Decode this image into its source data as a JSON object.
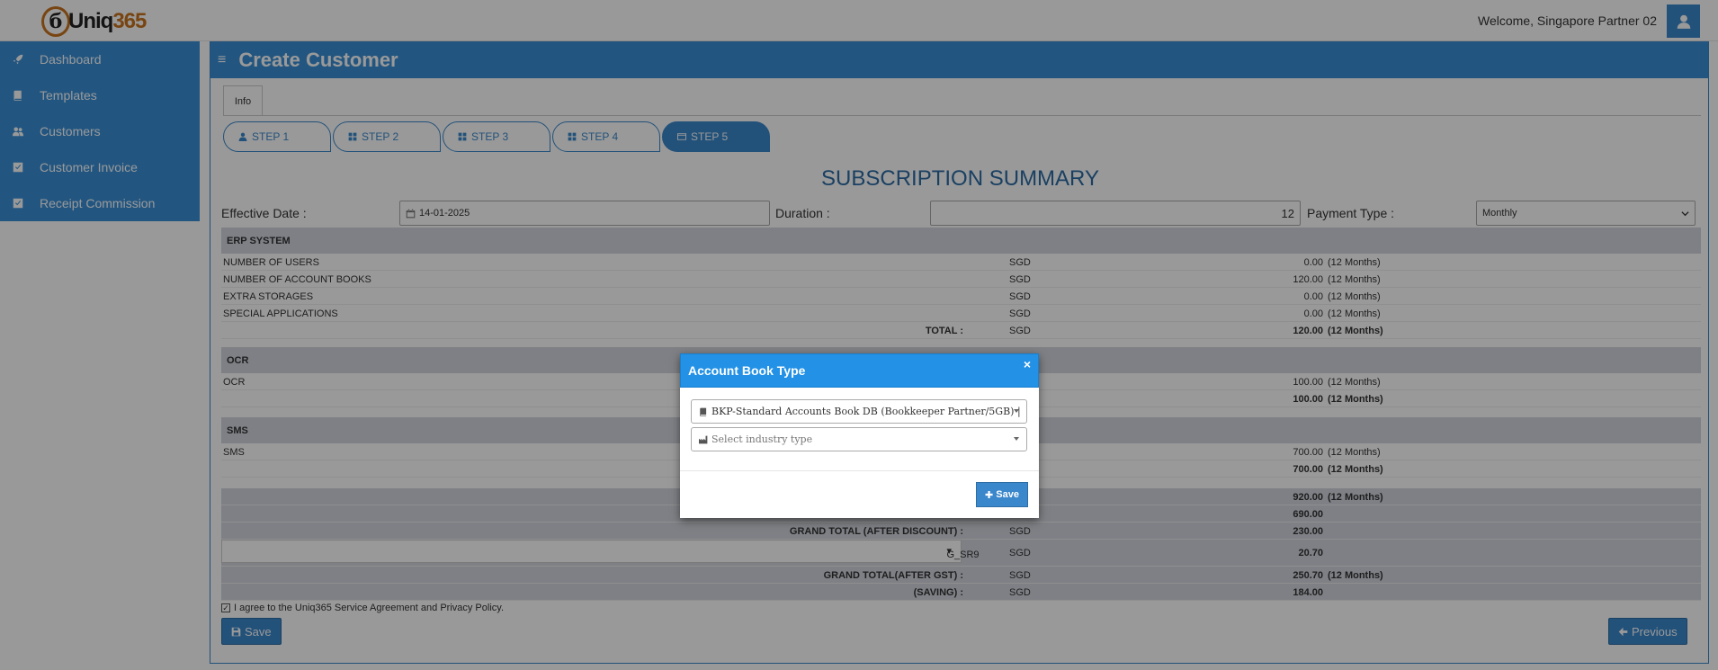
{
  "brand": {
    "logo_mark": "б",
    "logo_text": "Uniq",
    "logo_num": "365"
  },
  "header": {
    "welcome": "Welcome, Singapore Partner 02"
  },
  "sidebar": {
    "items": [
      {
        "label": "Dashboard",
        "icon": "rocket-icon"
      },
      {
        "label": "Templates",
        "icon": "book-icon"
      },
      {
        "label": "Customers",
        "icon": "users-icon"
      },
      {
        "label": "Customer Invoice",
        "icon": "check-square-icon"
      },
      {
        "label": "Receipt Commission",
        "icon": "check-square-icon"
      }
    ]
  },
  "page": {
    "menu_glyph": "≡",
    "title": "Create Customer",
    "info_tab": "Info"
  },
  "steps": [
    "STEP 1",
    "STEP 2",
    "STEP 3",
    "STEP 4",
    "STEP 5"
  ],
  "summary": {
    "title": "SUBSCRIPTION SUMMARY",
    "effective_label": "Effective Date :",
    "effective_value": "14-01-2025",
    "duration_label": "Duration :",
    "duration_value": "12",
    "payment_label": "Payment Type :",
    "payment_value": "Monthly",
    "erp": {
      "title": "ERP SYSTEM",
      "rows": [
        {
          "label": "NUMBER OF USERS",
          "cur": "SGD",
          "val": "0.00",
          "mon": "(12 Months)"
        },
        {
          "label": "NUMBER OF ACCOUNT BOOKS",
          "cur": "SGD",
          "val": "120.00",
          "mon": "(12 Months)"
        },
        {
          "label": "EXTRA STORAGES",
          "cur": "SGD",
          "val": "0.00",
          "mon": "(12 Months)"
        },
        {
          "label": "SPECIAL APPLICATIONS",
          "cur": "SGD",
          "val": "0.00",
          "mon": "(12 Months)"
        }
      ],
      "total_label": "TOTAL :",
      "total_cur": "SGD",
      "total_val": "120.00",
      "total_mon": "(12 Months)"
    },
    "ocr": {
      "title": "OCR",
      "label": "OCR",
      "val": "100.00",
      "mon": "(12 Months)",
      "total_val": "100.00",
      "total_mon": "(12 Months)"
    },
    "sms": {
      "title": "SMS",
      "label": "SMS",
      "val": "700.00",
      "mon": "(12 Months)",
      "total_val": "700.00",
      "total_mon": "(12 Months)"
    },
    "grand": {
      "row1_val": "920.00",
      "row1_mon": "(12 Months)",
      "row2_val": "690.00",
      "after_discount_label": "GRAND TOTAL (AFTER DISCOUNT) :",
      "after_discount_cur": "SGD",
      "after_discount_val": "230.00",
      "gst_select": "G_SR9 | GST 9%",
      "gst_cur": "SGD",
      "gst_val": "20.70",
      "after_gst_label": "GRAND TOTAL(AFTER GST) :",
      "after_gst_cur": "SGD",
      "after_gst_val": "250.70",
      "after_gst_mon": "(12 Months)",
      "saving_label": "(SAVING) :",
      "saving_cur": "SGD",
      "saving_val": "184.00"
    },
    "agree_text": "I agree to the Uniq365 Service Agreement and Privacy Policy.",
    "save_label": "Save",
    "previous_label": "Previous"
  },
  "modal": {
    "title": "Account Book Type",
    "close_glyph": "×",
    "book_type_value": "BKP-Standard Accounts Book DB (Bookkeeper Partner/5GB) |",
    "industry_placeholder": "Select industry type",
    "save_label": "Save"
  },
  "colors": {
    "primary": "#3a87cb",
    "sidebar": "#3a8fd8",
    "modal_header": "#2291e6"
  }
}
